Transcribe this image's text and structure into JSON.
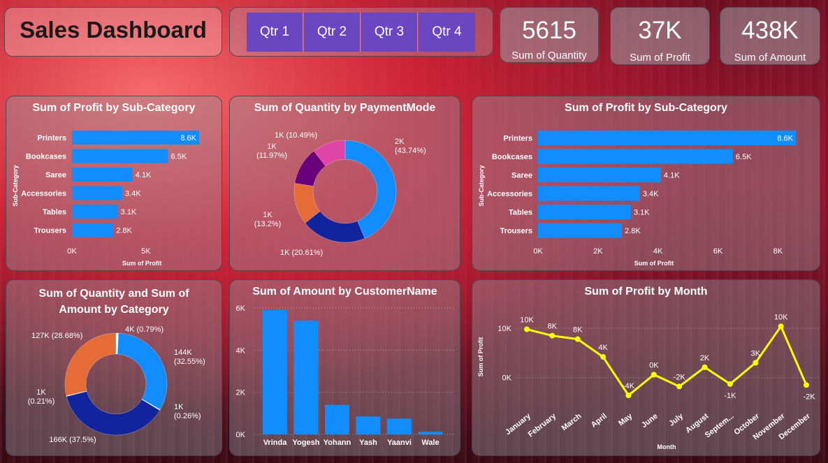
{
  "dashboard_title": "Sales Dashboard",
  "quarters": [
    "Qtr 1",
    "Qtr 2",
    "Qtr 3",
    "Qtr 4"
  ],
  "kpis": {
    "quantity": {
      "value": "5615",
      "label": "Sum of Quantity"
    },
    "profit": {
      "value": "37K",
      "label": "Sum of Profit"
    },
    "amount": {
      "value": "438K",
      "label": "Sum of Amount"
    }
  },
  "colors": {
    "bar": "#118dff",
    "line": "#ffff00",
    "accent": "#6b46c1"
  },
  "chart_data": [
    {
      "type": "bar",
      "orientation": "horizontal",
      "title": "Sum of Profit by Sub-Category",
      "xlabel": "Sum of Profit",
      "ylabel": "Sub-Category",
      "categories": [
        "Printers",
        "Bookcases",
        "Saree",
        "Accessories",
        "Tables",
        "Trousers"
      ],
      "values": [
        8600,
        6500,
        4100,
        3400,
        3100,
        2800
      ],
      "data_labels": [
        "8.6K",
        "6.5K",
        "4.1K",
        "3.4K",
        "3.1K",
        "2.8K"
      ],
      "xticks": [
        "0K",
        "5K"
      ],
      "xlim": [
        0,
        8600
      ]
    },
    {
      "type": "pie",
      "donut": true,
      "title": "Sum of Quantity by PaymentMode",
      "values": [
        43.74,
        20.61,
        13.2,
        11.97,
        10.49
      ],
      "colors": [
        "#118dff",
        "#12239e",
        "#e66c37",
        "#6b007b",
        "#e044a7"
      ],
      "labels": [
        "2K (43.74%)",
        "1K (20.61%)",
        "1K (13.2%)",
        "1K (11.97%)",
        "1K (10.49%)"
      ]
    },
    {
      "type": "bar",
      "orientation": "horizontal",
      "title": "Sum of Profit by Sub-Category",
      "xlabel": "Sum of Profit",
      "ylabel": "Sub-Category",
      "categories": [
        "Printers",
        "Bookcases",
        "Saree",
        "Accessories",
        "Tables",
        "Trousers"
      ],
      "values": [
        8600,
        6500,
        4100,
        3400,
        3100,
        2800
      ],
      "data_labels": [
        "8.6K",
        "6.5K",
        "4.1K",
        "3.4K",
        "3.1K",
        "2.8K"
      ],
      "xticks": [
        "0K",
        "2K",
        "4K",
        "6K",
        "8K"
      ],
      "xlim": [
        0,
        8600
      ]
    },
    {
      "type": "pie",
      "donut": true,
      "title": "Sum of Quantity and Sum of Amount by Category",
      "values": [
        0.79,
        32.55,
        0.26,
        37.5,
        0.21,
        28.68
      ],
      "colors": [
        "#ffffff",
        "#118dff",
        "#ffffff",
        "#12239e",
        "#ffffff",
        "#e66c37"
      ],
      "labels": [
        "4K (0.79%)",
        "144K (32.55%)",
        "1K (0.26%)",
        "166K (37.5%)",
        "1K (0.21%)",
        "127K (28.68%)"
      ]
    },
    {
      "type": "bar",
      "title": "Sum of Amount by CustomerName",
      "categories": [
        "Vrinda",
        "Yogesh",
        "Yohann",
        "Yash",
        "Yaanvi",
        "Wale"
      ],
      "values": [
        5900,
        5400,
        1400,
        850,
        750,
        120
      ],
      "yticks": [
        "0K",
        "2K",
        "4K",
        "6K"
      ],
      "ylim": [
        0,
        6000
      ]
    },
    {
      "type": "line",
      "title": "Sum of Profit by Month",
      "xlabel": "Month",
      "ylabel": "Sum of Profit",
      "categories": [
        "January",
        "February",
        "March",
        "April",
        "May",
        "June",
        "July",
        "August",
        "Septem...",
        "October",
        "November",
        "December"
      ],
      "values": [
        9800,
        8500,
        7800,
        4200,
        -3600,
        600,
        -1800,
        2100,
        -1300,
        3000,
        10400,
        -1500
      ],
      "data_labels": [
        "10K",
        "8K",
        "8K",
        "4K",
        "-4K",
        "0K",
        "-2K",
        "2K",
        "-1K",
        "3K",
        "10K",
        "-2K"
      ],
      "yticks": [
        "0K",
        "10K"
      ],
      "ylim": [
        -5000,
        12000
      ]
    }
  ]
}
